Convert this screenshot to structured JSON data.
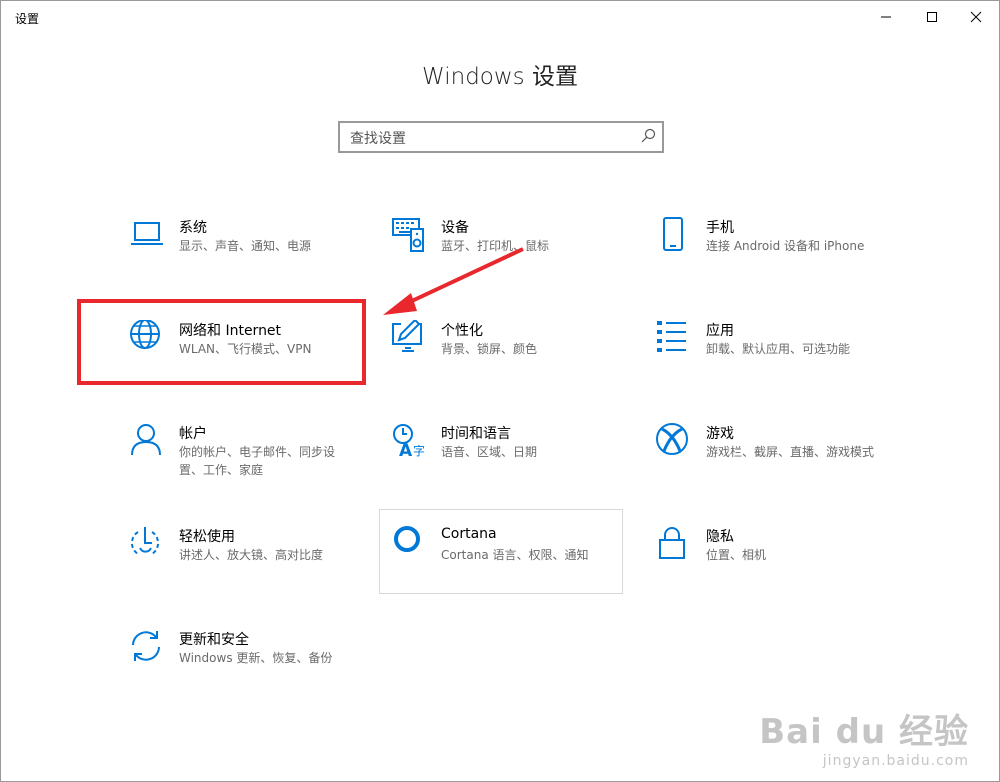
{
  "window": {
    "title": "设置"
  },
  "header": {
    "title": "Windows 设置"
  },
  "search": {
    "placeholder": "查找设置"
  },
  "accent": "#0078d7",
  "tiles": [
    {
      "icon": "laptop-icon",
      "name": "系统",
      "desc": "显示、声音、通知、电源"
    },
    {
      "icon": "keyboard-speaker-icon",
      "name": "设备",
      "desc": "蓝牙、打印机、鼠标"
    },
    {
      "icon": "phone-icon",
      "name": "手机",
      "desc": "连接 Android 设备和 iPhone"
    },
    {
      "icon": "globe-icon",
      "name": "网络和 Internet",
      "desc": "WLAN、飞行模式、VPN"
    },
    {
      "icon": "paint-monitor-icon",
      "name": "个性化",
      "desc": "背景、锁屏、颜色"
    },
    {
      "icon": "apps-list-icon",
      "name": "应用",
      "desc": "卸载、默认应用、可选功能"
    },
    {
      "icon": "person-icon",
      "name": "帐户",
      "desc": "你的帐户、电子邮件、同步设置、工作、家庭"
    },
    {
      "icon": "time-language-icon",
      "name": "时间和语言",
      "desc": "语音、区域、日期"
    },
    {
      "icon": "xbox-icon",
      "name": "游戏",
      "desc": "游戏栏、截屏、直播、游戏模式"
    },
    {
      "icon": "ease-of-access-icon",
      "name": "轻松使用",
      "desc": "讲述人、放大镜、高对比度"
    },
    {
      "icon": "cortana-icon",
      "name": "Cortana",
      "desc": "Cortana 语言、权限、通知"
    },
    {
      "icon": "lock-icon",
      "name": "隐私",
      "desc": "位置、相机"
    },
    {
      "icon": "update-icon",
      "name": "更新和安全",
      "desc": "Windows 更新、恢复、备份"
    }
  ],
  "annotation": {
    "color": "#e8282d"
  },
  "watermark": {
    "line1": "Bai du 经验",
    "line2": "jingyan.baidu.com"
  }
}
